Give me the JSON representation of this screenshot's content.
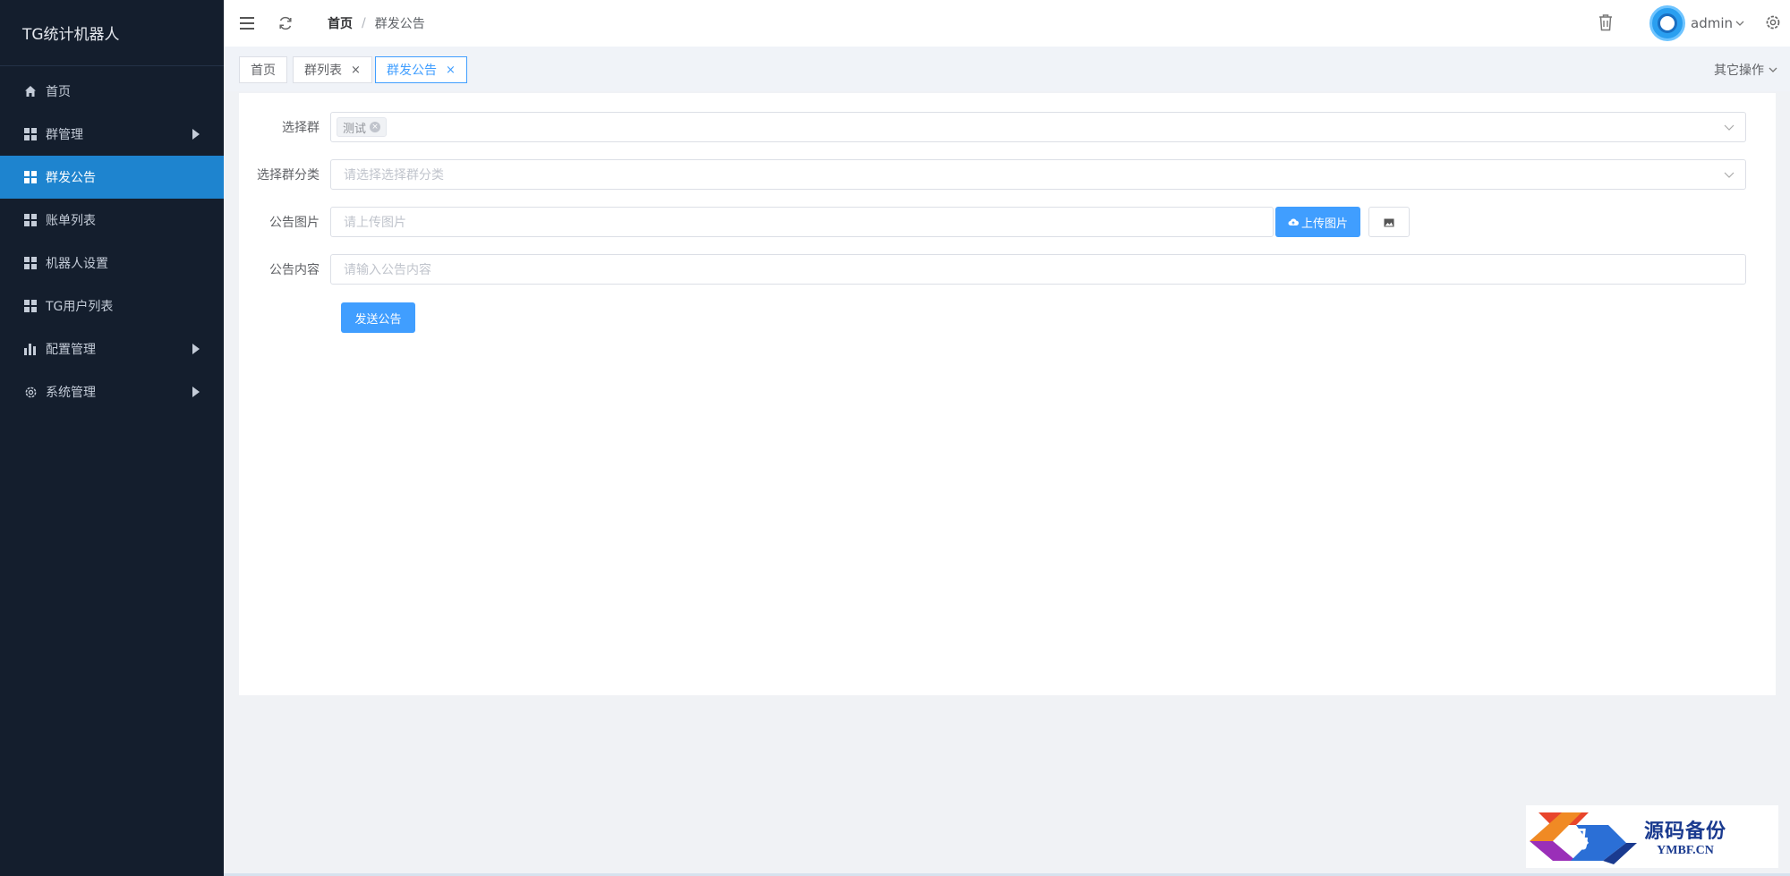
{
  "app": {
    "title": "TG统计机器人"
  },
  "sidebar": {
    "items": [
      {
        "label": "首页",
        "icon": "home-icon",
        "active": false,
        "has_arrow": false
      },
      {
        "label": "群管理",
        "icon": "grid-icon",
        "active": false,
        "has_arrow": true
      },
      {
        "label": "群发公告",
        "icon": "grid-icon",
        "active": true,
        "has_arrow": false
      },
      {
        "label": "账单列表",
        "icon": "grid-icon",
        "active": false,
        "has_arrow": false
      },
      {
        "label": "机器人设置",
        "icon": "grid-icon",
        "active": false,
        "has_arrow": false
      },
      {
        "label": "TG用户列表",
        "icon": "grid-icon",
        "active": false,
        "has_arrow": false
      },
      {
        "label": "配置管理",
        "icon": "bar-chart-icon",
        "active": false,
        "has_arrow": true
      },
      {
        "label": "系统管理",
        "icon": "gear-icon",
        "active": false,
        "has_arrow": true
      }
    ]
  },
  "header": {
    "breadcrumb": {
      "home": "首页",
      "separator": "/",
      "current": "群发公告"
    },
    "user": {
      "name": "admin"
    }
  },
  "tags": {
    "items": [
      {
        "label": "首页",
        "closable": false,
        "active": false
      },
      {
        "label": "群列表",
        "closable": true,
        "active": false
      },
      {
        "label": "群发公告",
        "closable": true,
        "active": true
      }
    ],
    "close_glyph": "×",
    "other_ops": "其它操作"
  },
  "form": {
    "group": {
      "label": "选择群",
      "chip": "测试",
      "chip_close": "×"
    },
    "category": {
      "label": "选择群分类",
      "placeholder": "请选择选择群分类"
    },
    "image": {
      "label": "公告图片",
      "placeholder": "请上传图片",
      "upload_button": "上传图片"
    },
    "content": {
      "label": "公告内容",
      "placeholder": "请输入公告内容"
    },
    "submit": {
      "label": "发送公告"
    }
  },
  "watermark": {
    "logo_char": "码",
    "title": "源码备份",
    "subtitle": "YMBF.CN"
  },
  "colors": {
    "sidebar_bg": "#141e2d",
    "active_bg": "#1e84cf",
    "primary": "#409eff",
    "page_bg": "#f0f2f5"
  }
}
